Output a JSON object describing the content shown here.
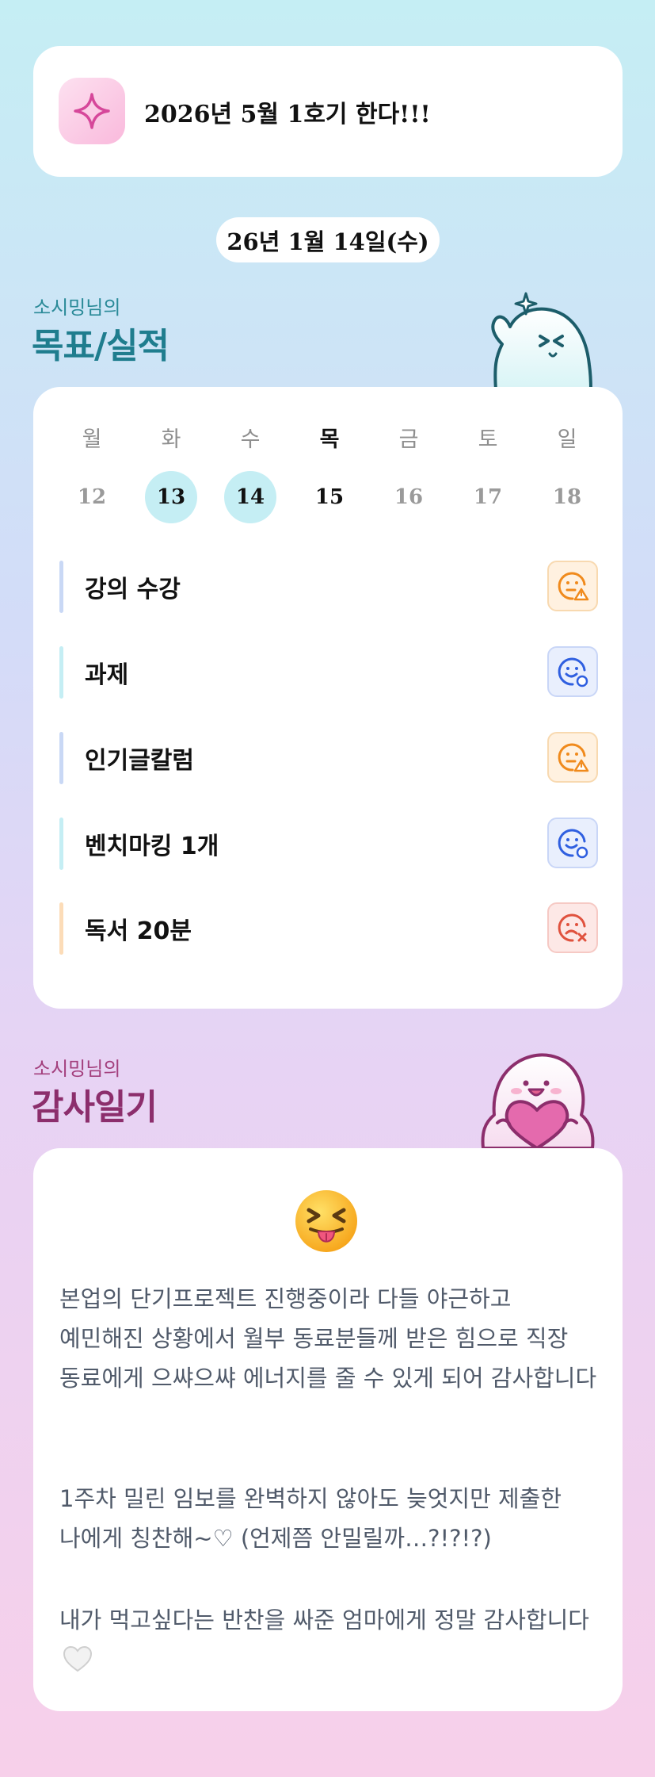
{
  "goal": {
    "icon": "sparkle-icon",
    "text": "2026년 5월 1호기 한다!!!"
  },
  "date_label": "26년 1월 14일(수)",
  "performance": {
    "owner_label": "소시밍님의",
    "title": "목표/실적",
    "mascot": "waving-mascot",
    "weekdays": [
      "월",
      "화",
      "수",
      "목",
      "금",
      "토",
      "일"
    ],
    "dates": [
      "12",
      "13",
      "14",
      "15",
      "16",
      "17",
      "18"
    ],
    "selected_dates": [
      "13",
      "14"
    ],
    "today": "15",
    "tasks": [
      {
        "label": "강의 수강",
        "bar_color": "#c9d8f5",
        "status": "warn",
        "status_icon": "meh-face-warning-icon"
      },
      {
        "label": "과제",
        "bar_color": "#c5eef4",
        "status": "ok",
        "status_icon": "smile-face-check-icon"
      },
      {
        "label": "인기글칼럼",
        "bar_color": "#c9d8f5",
        "status": "warn",
        "status_icon": "meh-face-warning-icon"
      },
      {
        "label": "벤치마킹 1개",
        "bar_color": "#c5eef4",
        "status": "ok",
        "status_icon": "smile-face-check-icon"
      },
      {
        "label": "독서 20분",
        "bar_color": "#fcdcb8",
        "status": "bad",
        "status_icon": "sad-face-x-icon"
      }
    ],
    "colors": {
      "warn": "#f08a1c",
      "ok": "#2f5fe0",
      "bad": "#e0523e"
    }
  },
  "gratitude": {
    "owner_label": "소시밍님의",
    "title": "감사일기",
    "mascot": "heart-hugging-mascot",
    "emoji": "squinting-tongue-emoji",
    "paragraphs": [
      "본업의 단기프로젝트 진행중이라 다들 야근하고 예민해진 상황에서 월부 동료분들께 받은 힘으로 직장 동료에게 으쌰으쌰 에너지를 줄 수 있게 되어 감사합니다",
      "1주차 밀린 임보를 완벽하지 않아도 늦엇지만 제출한 나에게 칭찬해~♡ (언제쯤 안밀릴까…?!?!?)",
      "내가 먹고싶다는 반찬을 싸준 엄마에게 정말 감사합니다"
    ],
    "last_icon": "white-heart-icon"
  }
}
